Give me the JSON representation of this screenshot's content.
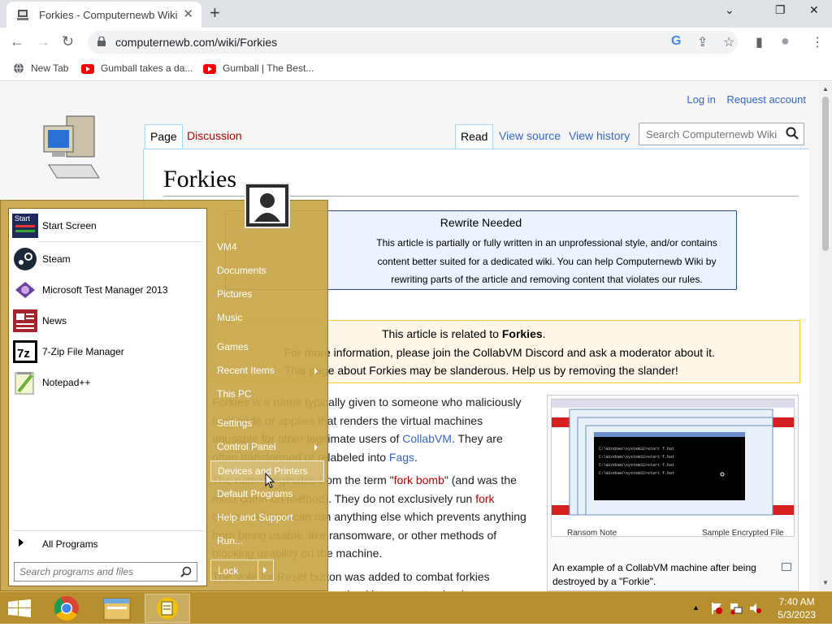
{
  "browser": {
    "tab_title": "Forkies - Computernewb Wiki",
    "tab_close": "✕",
    "new_tab": "+",
    "window_controls": {
      "minimize": "⌄",
      "restore": "❐",
      "close": "✕"
    },
    "url": "computernewb.com/wiki/Forkies",
    "nav": {
      "back": "←",
      "forward": "→",
      "reload": "↻"
    },
    "omni_icons": {
      "google": "G",
      "share": "⇪",
      "bookmark": "☆"
    },
    "toolbar_icons": {
      "side_panel": "▮",
      "profile": "●",
      "menu": "⋮"
    },
    "bookmarks": [
      {
        "label": "New Tab",
        "icon": "globe-icon"
      },
      {
        "label": "Gumball takes a da...",
        "icon": "youtube-icon"
      },
      {
        "label": "Gumball | The Best...",
        "icon": "youtube-icon"
      }
    ]
  },
  "wiki": {
    "login": "Log in",
    "request_account": "Request account",
    "tabs_left": [
      "Page",
      "Discussion"
    ],
    "tabs_right": [
      "Read",
      "View source",
      "View history"
    ],
    "search_placeholder": "Search Computernewb Wiki",
    "title": "Forkies",
    "rewrite": {
      "heading": "Rewrite Needed",
      "text": "This article is partially or fully written in an unprofessional style, and/or contains content better suited for a dedicated wiki. You can help Computernewb Wiki by rewriting parts of the article and removing content that violates our rules."
    },
    "notice_lines": [
      {
        "pre": "This article is related to ",
        "bold": "Forkies",
        "post": "."
      },
      {
        "pre": "For more information, please join the CollabVM Discord and ask a moderator about it.",
        "bold": "",
        "post": ""
      },
      {
        "pre": "This page about Forkies may be slanderous. Help us by removing the slander!",
        "bold": "",
        "post": ""
      }
    ],
    "body": {
      "p1_a": "Forkies is a name typically given to someone who maliciously runs code or applies that renders the virtual machines unusable for other legitimate users of ",
      "p1_link1": "CollabVM",
      "p1_b": ". They are often transformed or relabeled into ",
      "p1_link2": "Fags",
      "p1_c": ".",
      "p2_a": "The name originates from the term \"",
      "p2_link1": "fork bomb",
      "p2_b": "\" (and was the most common method). They do not exclusively run ",
      "p2_link2": "fork bombs",
      "p2_c": ". A forkie can run anything else which prevents anything from being usable, like ransomware, or other methods of blocking usability on the machine.",
      "p3": "The Vote for Reset button was added to combat forkies alongside a task manager (and later a customized"
    },
    "thumb_caption": "An example of a CollabVM machine after being destroyed by a \"Forkie\".",
    "thumb_labels": {
      "left": "Ransom Note",
      "right": "Sample Encrypted File"
    }
  },
  "startmenu": {
    "left_items": [
      {
        "label": "Start Screen",
        "icon": "start-screen-icon"
      },
      {
        "label": "Steam",
        "icon": "steam-icon"
      },
      {
        "label": "Microsoft Test Manager 2013",
        "icon": "test-manager-icon"
      },
      {
        "label": "News",
        "icon": "news-icon"
      },
      {
        "label": "7-Zip File Manager",
        "icon": "7zip-icon"
      },
      {
        "label": "Notepad++",
        "icon": "notepadpp-icon"
      }
    ],
    "start_icon_text": "Start",
    "all_programs": "All Programs",
    "search_placeholder": "Search programs and files",
    "right_items": [
      "VM4",
      "Documents",
      "Pictures",
      "Music",
      "Games",
      "Recent Items",
      "This PC",
      "Settings",
      "Control Panel",
      "Devices and Printers",
      "Default Programs",
      "Help and Support",
      "Run..."
    ],
    "lock": "Lock"
  },
  "taskbar": {
    "time": "7:40 AM",
    "date": "5/3/2023",
    "tray_arrow": "▲"
  },
  "colors": {
    "taskbar": "#b88f2e",
    "startmenu": "#c8a646",
    "link": "#3366cc",
    "redlink": "#ba0000"
  }
}
